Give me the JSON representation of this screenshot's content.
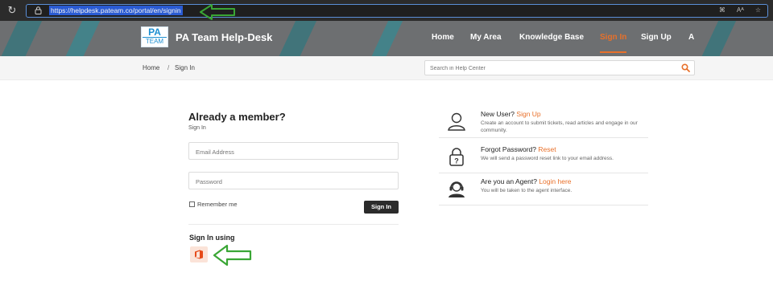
{
  "browser": {
    "url": "https://helpdesk.pateam.co/portal/en/signin",
    "address_icons": [
      "⌘",
      "Aᴬ",
      "☆"
    ]
  },
  "header": {
    "logo_top": "PA",
    "logo_bottom": "TEAM",
    "brand": "PA Team Help-Desk",
    "nav": {
      "home": "Home",
      "my_area": "My Area",
      "knowledge_base": "Knowledge Base",
      "sign_in": "Sign In",
      "sign_up": "Sign Up",
      "accessibility": "A"
    },
    "active_nav": "Sign In"
  },
  "breadcrumb": {
    "home": "Home",
    "separator": "/",
    "current": "Sign In",
    "search_placeholder": "Search in Help Center"
  },
  "form": {
    "title": "Already a member?",
    "subtitle": "Sign In",
    "email_placeholder": "Email Address",
    "password_placeholder": "Password",
    "remember_label": "Remember me",
    "remember_checked": false,
    "submit_label": "Sign In",
    "sign_in_using": "Sign In using"
  },
  "info_panel": [
    {
      "title": "New User?",
      "link": "Sign Up",
      "desc": "Create an account to submit tickets, read articles and engage in our community.",
      "icon": "user-icon"
    },
    {
      "title": "Forgot Password?",
      "link": "Reset",
      "desc": "We will send a password reset link to your email address.",
      "icon": "padlock-question-icon"
    },
    {
      "title": "Are you an Agent?",
      "link": "Login here",
      "desc": "You will be taken to the agent interface.",
      "icon": "headset-agent-icon"
    }
  ],
  "colors": {
    "accent": "#e8702a",
    "header_bg": "#6e6f71",
    "teal": "#0c7b85",
    "annotation_arrow": "#3aa635"
  }
}
